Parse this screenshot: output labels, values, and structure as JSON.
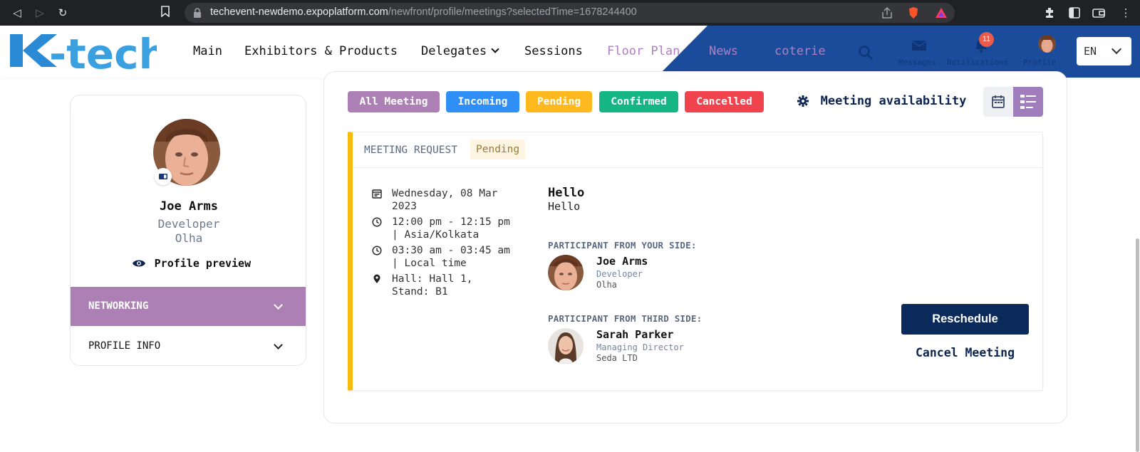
{
  "browser": {
    "url_domain": "techevent-newdemo.expoplatform.com",
    "url_path": "/newfront/profile/meetings?selectedTime=1678244400"
  },
  "header": {
    "logo_text": "K-tech",
    "nav": [
      {
        "label": "Main"
      },
      {
        "label": "Exhibitors & Products"
      },
      {
        "label": "Delegates"
      },
      {
        "label": "Sessions"
      },
      {
        "label": "Floor Plan"
      },
      {
        "label": "News"
      },
      {
        "label": "coterie"
      }
    ],
    "icons": {
      "messages": "Messages",
      "notifications": "Notifications",
      "profile": "Profile"
    },
    "notification_count": "11",
    "language": "EN"
  },
  "profile": {
    "name": "Joe Arms",
    "role": "Developer",
    "company": "Olha",
    "preview_label": "Profile preview",
    "accordion": [
      {
        "label": "NETWORKING"
      },
      {
        "label": "PROFILE INFO"
      }
    ]
  },
  "filters": {
    "all": "All Meeting",
    "incoming": "Incoming",
    "pending": "Pending",
    "confirmed": "Confirmed",
    "cancelled": "Cancelled"
  },
  "availability_label": "Meeting availability",
  "meeting": {
    "header_label": "MEETING REQUEST",
    "status": "Pending",
    "date_line1": "Wednesday, 08 Mar",
    "date_line2": "2023",
    "time_line1": "12:00 pm - 12:15 pm",
    "time_line2": "| Asia/Kolkata",
    "local_line1": "03:30 am - 03:45 am",
    "local_line2": "| Local time",
    "location_line1": "Hall: Hall 1,",
    "location_line2": "Stand: B1",
    "title": "Hello",
    "message": "Hello",
    "your_side_label": "PARTICIPANT FROM YOUR SIDE:",
    "your_participant": {
      "name": "Joe Arms",
      "role": "Developer",
      "company": "Olha"
    },
    "third_side_label": "PARTICIPANT FROM THIRD SIDE:",
    "third_participant": {
      "name": "Sarah Parker",
      "role": "Managing Director",
      "company": "Seda LTD"
    },
    "reschedule_label": "Reschedule",
    "cancel_label": "Cancel Meeting"
  },
  "colors": {
    "accent_purple": "#ad80b5",
    "incoming_blue": "#2f8ff7",
    "pending_yellow": "#ffb81e",
    "confirmed_green": "#15b684",
    "cancelled_red": "#f0434e",
    "navy": "#0a2a5c",
    "header_blue": "#1b4c9b"
  }
}
